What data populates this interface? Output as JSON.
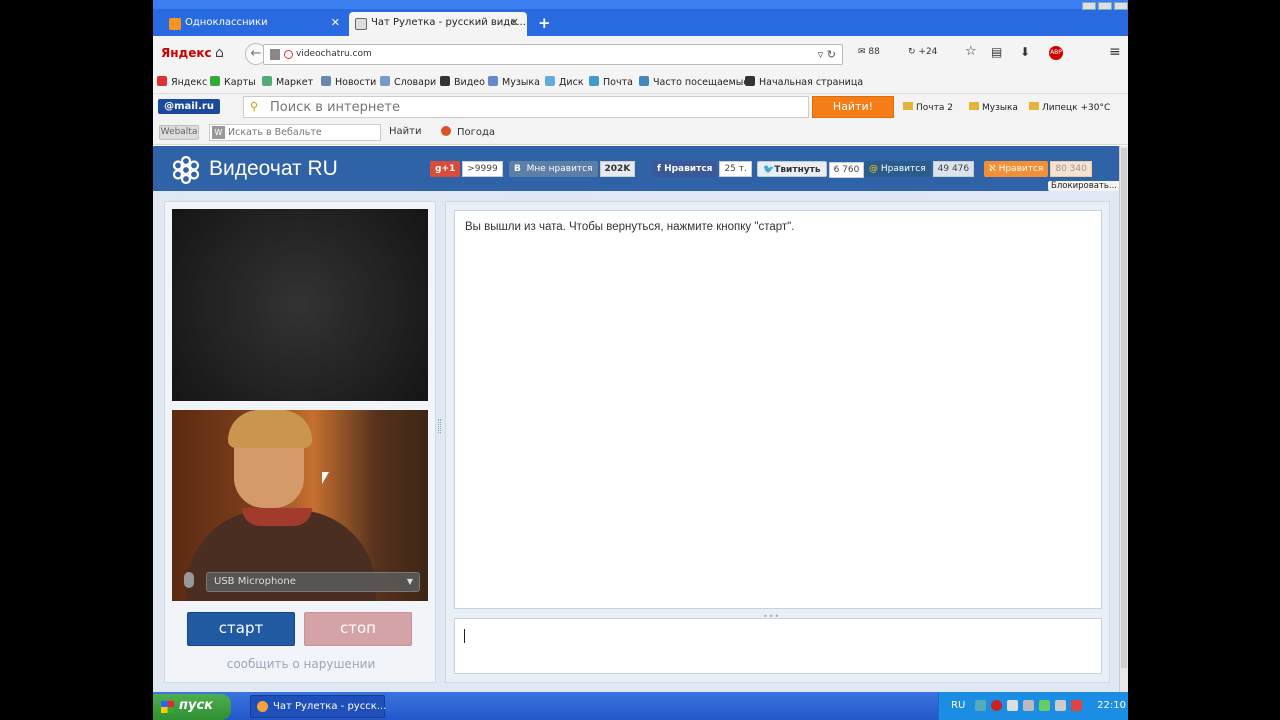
{
  "browser": {
    "tabs": [
      {
        "label": "Одноклассники"
      },
      {
        "label": "Чат Рулетка - русский виде..."
      }
    ],
    "new_tab": "+",
    "yandex_logo": "Яндекс",
    "url": "videochatru.com",
    "mail_count": "88",
    "sync_count": "+24",
    "bookmarks": [
      "Яндекс",
      "Карты",
      "Маркет",
      "Новости",
      "Словари",
      "Видео",
      "Музыка",
      "Диск",
      "Почта",
      "Часто посещаемые",
      "Начальная страница"
    ],
    "mail_toolbar": {
      "logo": "@mail.ru",
      "search_placeholder": "Поиск в интернете",
      "find_button": "Найти!",
      "mail_link": "Почта 2",
      "music_link": "Музыка",
      "weather_link": "Липецк +30°C"
    },
    "webalta": {
      "logo": "Webalta",
      "search_placeholder": "Искать в Вебальте",
      "find": "Найти",
      "weather": "Погода"
    }
  },
  "site": {
    "title": "Видеочат RU",
    "social": {
      "gplus_label": "g+1",
      "gplus_count": ">9999",
      "vk_label": "Мне нравится",
      "vk_count": "202K",
      "fb_label": "Нравится",
      "fb_count": "25 т.",
      "tw_label": "Твитнуть",
      "tw_count": "6 760",
      "mailru_label": "Нравится",
      "mailru_count": "49 476",
      "ok_label": "Нравится",
      "ok_count": "80 340",
      "block": "Блокировать..."
    },
    "mic_select": "USB Microphone",
    "start_button": "старт",
    "stop_button": "стоп",
    "report_link": "сообщить о нарушении",
    "chat_message": "Вы вышли из чата. Чтобы вернуться, нажмите кнопку \"старт\"."
  },
  "taskbar": {
    "start": "пуск",
    "task": "Чат Рулетка - русск...",
    "lang": "RU",
    "clock": "22:10"
  }
}
